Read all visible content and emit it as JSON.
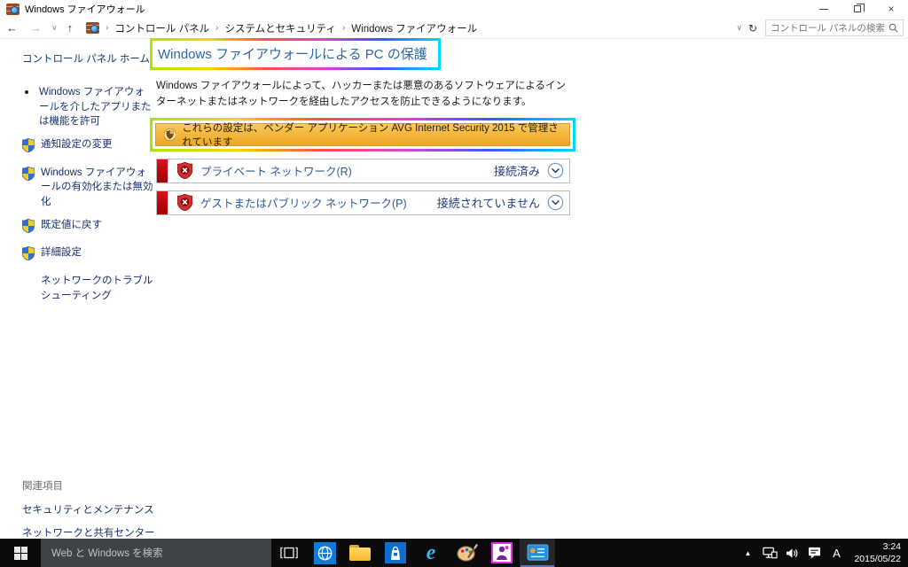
{
  "window": {
    "title": "Windows ファイアウォール",
    "close_glyph": "×"
  },
  "navbar": {
    "back_glyph": "←",
    "forward_glyph": "→",
    "up_glyph": "↑",
    "dropdown_glyph": "∨",
    "refresh_glyph": "↻",
    "separator": "›",
    "breadcrumb": [
      {
        "label": "コントロール パネル"
      },
      {
        "label": "システムとセキュリティ"
      },
      {
        "label": "Windows ファイアウォール"
      }
    ],
    "search_placeholder": "コントロール パネルの検索"
  },
  "sidebar": {
    "home": "コントロール パネル ホーム",
    "items": [
      {
        "label": "Windows ファイアウォールを介したアプリまたは機能を許可",
        "icon": "bullet"
      },
      {
        "label": "通知設定の変更",
        "icon": "uac-shield"
      },
      {
        "label": "Windows ファイアウォールの有効化または無効化",
        "icon": "uac-shield"
      },
      {
        "label": "既定値に戻す",
        "icon": "uac-shield"
      },
      {
        "label": "詳細設定",
        "icon": "uac-shield"
      },
      {
        "label": "ネットワークのトラブルシューティング",
        "icon": "none"
      }
    ],
    "related": {
      "header": "関連項目",
      "links": [
        {
          "label": "セキュリティとメンテナンス"
        },
        {
          "label": "ネットワークと共有センター"
        }
      ]
    }
  },
  "main": {
    "heading": "Windows ファイアウォールによる PC の保護",
    "description": "Windows ファイアウォールによって、ハッカーまたは悪意のあるソフトウェアによるインターネットまたはネットワークを経由したアクセスを防止できるようになります。",
    "banner": {
      "icon": "security-shield-icon",
      "text": "これらの設定は、ベンダー アプリケーション AVG Internet Security 2015 で管理されています"
    },
    "networks": [
      {
        "label": "プライベート ネットワーク(R)",
        "status": "接続済み",
        "state_icon": "red-shield-x-icon"
      },
      {
        "label": "ゲストまたはパブリック ネットワーク(P)",
        "status": "接続されていません",
        "state_icon": "red-shield-x-icon"
      }
    ]
  },
  "taskbar": {
    "search_placeholder": "Web と Windows を検索",
    "apps": [
      {
        "icon": "globe-tile-icon"
      },
      {
        "icon": "file-explorer-icon"
      },
      {
        "icon": "store-icon"
      },
      {
        "icon": "internet-explorer-icon"
      },
      {
        "icon": "paint-icon"
      },
      {
        "icon": "photo-app-icon"
      },
      {
        "icon": "control-panel-icon",
        "active": true
      }
    ],
    "tray": {
      "expand_glyph": "▲",
      "ime_mode": "A",
      "time": "3:24",
      "date": "2015/05/22"
    }
  },
  "colors": {
    "banner_orange": "#f3b93e",
    "annotation_gradient": [
      "#a8e800",
      "#ffd000",
      "#ff5040",
      "#e040d0",
      "#3858ff",
      "#00d8ff"
    ],
    "heading_blue": "#2a66ad",
    "alert_red": "#c00a12",
    "taskbar_black": "#0b0b0c",
    "active_underline": "#4f7ab8"
  }
}
